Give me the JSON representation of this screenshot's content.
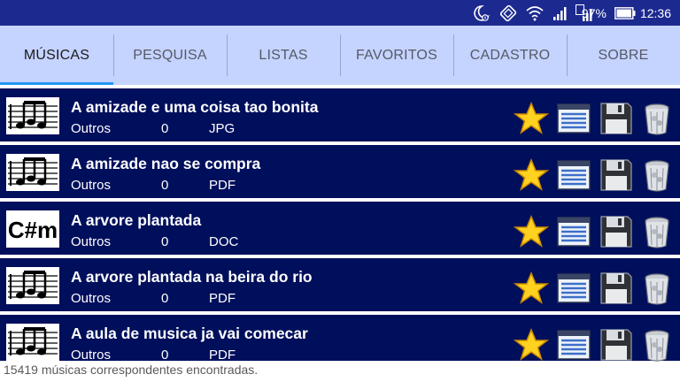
{
  "status_bar": {
    "battery": "97%",
    "time": "12:36",
    "icons": [
      "do-not-disturb-moon-icon",
      "rotation-lock-icon",
      "wifi-icon",
      "signal-1-icon",
      "signal-2-icon",
      "battery-icon"
    ],
    "sim_label": "2"
  },
  "tabs": [
    {
      "label": "MÚSICAS",
      "active": true
    },
    {
      "label": "PESQUISA",
      "active": false
    },
    {
      "label": "LISTAS",
      "active": false
    },
    {
      "label": "FAVORITOS",
      "active": false
    },
    {
      "label": "CADASTRO",
      "active": false
    },
    {
      "label": "SOBRE",
      "active": false
    }
  ],
  "songs": [
    {
      "title": "A amizade e uma coisa tao bonita",
      "category": "Outros",
      "count": "0",
      "type": "JPG",
      "thumb": "sheet-music-icon"
    },
    {
      "title": "A amizade nao se compra",
      "category": "Outros",
      "count": "0",
      "type": "PDF",
      "thumb": "sheet-music-icon"
    },
    {
      "title": "A arvore plantada",
      "category": "Outros",
      "count": "0",
      "type": "DOC",
      "thumb": "chord-icon",
      "thumb_text": "C#m"
    },
    {
      "title": "A arvore plantada na beira do rio",
      "category": "Outros",
      "count": "0",
      "type": "PDF",
      "thumb": "sheet-music-icon"
    },
    {
      "title": "A aula de musica ja vai comecar",
      "category": "Outros",
      "count": "0",
      "type": "PDF",
      "thumb": "sheet-music-icon"
    }
  ],
  "actions": [
    "star-icon",
    "list-view-icon",
    "floppy-save-icon",
    "trash-bin-icon"
  ],
  "footer": {
    "result_text": "15419 músicas correspondentes encontradas."
  },
  "colors": {
    "status_bar": "#1c2a8f",
    "tab_bar": "#c5d3ff",
    "tab_indicator": "#2196f3",
    "row_background": "#000f5c"
  }
}
